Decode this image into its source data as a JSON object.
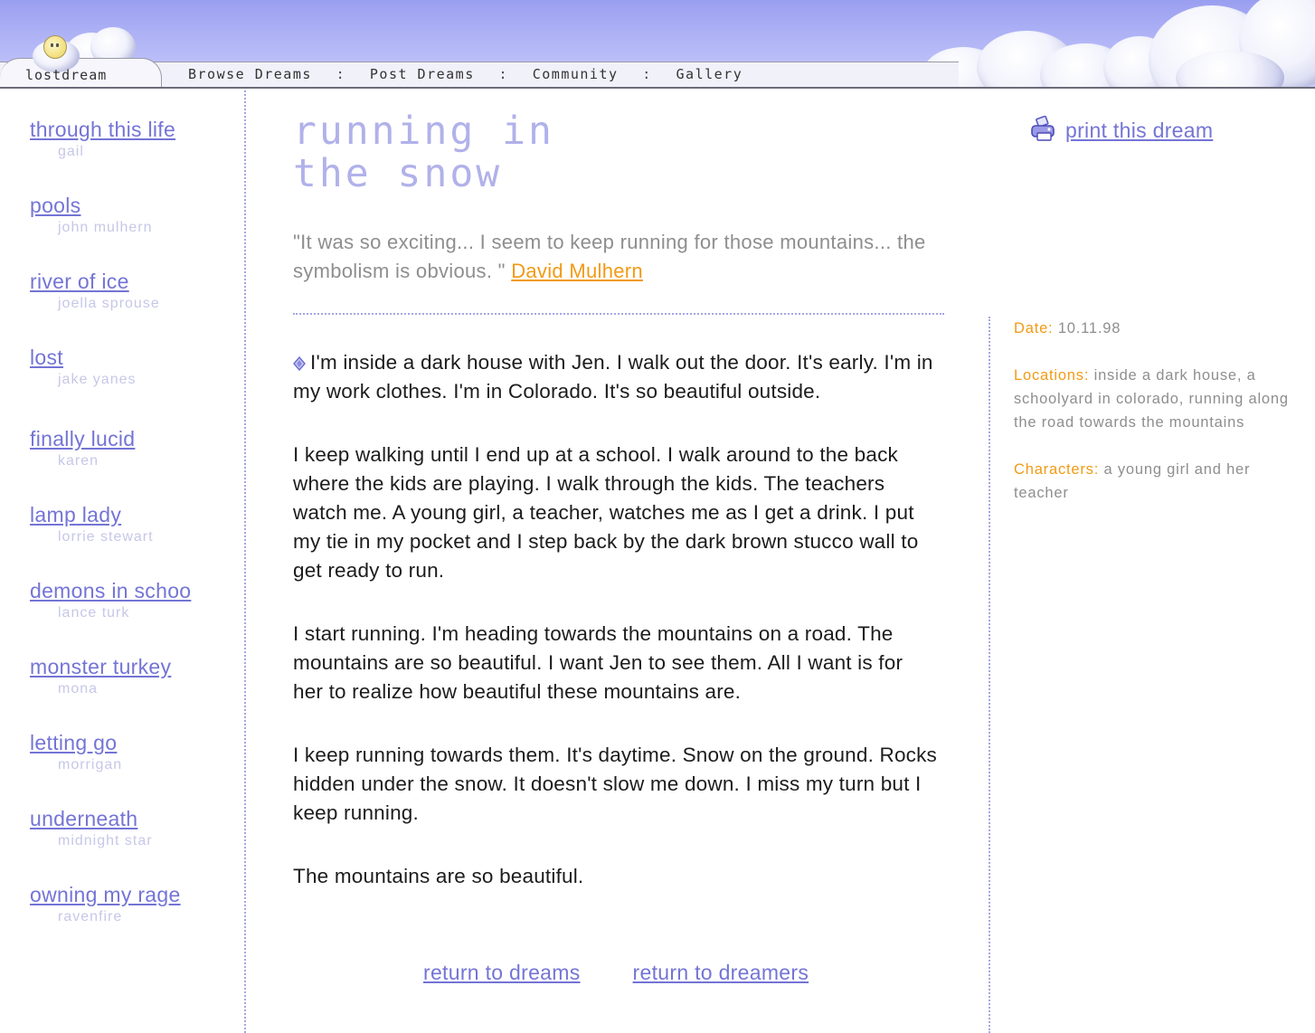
{
  "header": {
    "logo_text": "lostdream",
    "nav": [
      {
        "label": "Browse Dreams"
      },
      {
        "label": "Post Dreams"
      },
      {
        "label": "Community"
      },
      {
        "label": "Gallery"
      }
    ],
    "separator": ":"
  },
  "sidebar": {
    "items": [
      {
        "title": "through this life",
        "author": "gail"
      },
      {
        "title": "pools",
        "author": "john mulhern"
      },
      {
        "title": "river of ice",
        "author": "joella sprouse"
      },
      {
        "title": "lost",
        "author": "jake yanes"
      },
      {
        "title": "finally lucid",
        "author": "karen"
      },
      {
        "title": "lamp lady",
        "author": "lorrie stewart"
      },
      {
        "title": "demons in schoo",
        "author": "lance turk"
      },
      {
        "title": "monster turkey",
        "author": "mona"
      },
      {
        "title": "letting go",
        "author": "morrigan"
      },
      {
        "title": "underneath",
        "author": "midnight star"
      },
      {
        "title": "owning my rage",
        "author": "ravenfire"
      }
    ]
  },
  "main": {
    "title_line1": "running in",
    "title_line2": "the snow",
    "quote_text": "\"It was so exciting... I seem to keep running for those mountains... the symbolism is obvious. \"",
    "quote_author": "David Mulhern",
    "story": [
      "I'm inside a dark house with Jen. I walk out the door. It's early. I'm in my work clothes. I'm in Colorado. It's so beautiful outside.",
      "I keep walking until I end up at a school. I walk around to the back where the kids are playing. I walk through the kids. The teachers watch me. A young girl, a teacher, watches me as I get a drink. I put my tie in my pocket and I step back by the dark brown stucco wall to get ready to run.",
      "I start running. I'm heading towards the mountains on a road. The mountains are so beautiful. I want Jen to see them. All I want is for her to realize how beautiful these mountains are.",
      "I keep running towards them. It's daytime. Snow on the ground. Rocks hidden under the snow. It doesn't slow me down. I miss my turn but I keep running.",
      "The mountains are so beautiful."
    ],
    "return_dreams": "return to dreams",
    "return_dreamers": "return to dreamers"
  },
  "aside": {
    "print_label": "print this dream",
    "date_label": "Date:",
    "date_value": "10.11.98",
    "locations_label": "Locations:",
    "locations_value": "inside a dark house, a schoolyard in colorado, running along the road towards the mountains",
    "characters_label": "Characters:",
    "characters_value": "a young girl and her teacher"
  },
  "colors": {
    "link": "#7474d6",
    "accent": "#f29a14",
    "muted": "#8e8e8e",
    "title": "#b1b1ea"
  }
}
